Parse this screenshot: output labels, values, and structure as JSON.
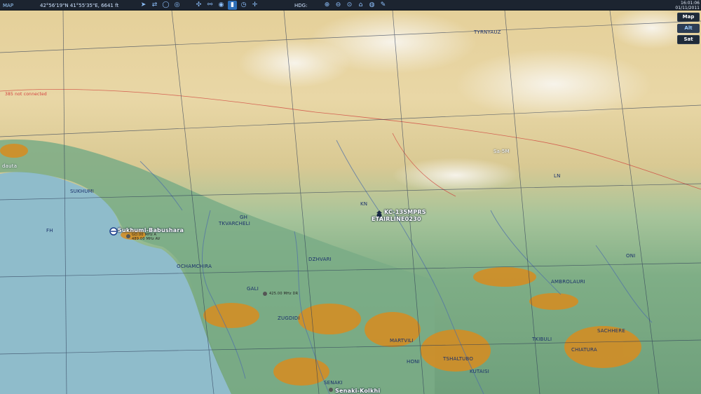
{
  "topbar": {
    "mode_label": "MAP",
    "coordinates": "42°56'19\"N 41°55'35\"E, 6641 ft",
    "hdg_label": "HDG:"
  },
  "clock": {
    "time": "16:01:06",
    "date": "01/11/2011"
  },
  "side_buttons": {
    "map": "Map",
    "alt": "Alt",
    "sat": "Sat"
  },
  "labels": {
    "tyrnyauz": "TYRNYAUZ",
    "dauta": "dauta",
    "sukhumi": "SUKHUMI",
    "fh": "FH",
    "gh": "GH",
    "tkvarcheli": "TKVARCHELI",
    "airport": "Sukhumi-Babushara",
    "freq1": "GD.00 MHz A",
    "freq2": "489.00 MHz AV",
    "ochamchira": "OCHAMCHIRA",
    "gali": "GALI",
    "freq3": "425.00 MHz DR",
    "dzhvari": "DZHVARI",
    "zugdidi": "ZUGDIDI",
    "martvili": "MARTVILI",
    "khoni": "HONI",
    "tskaltubo": "TSHALTUBO",
    "kutaisi": "KUTAISI",
    "senaki": "SENAKI",
    "kolkhi": "Senaki-Kolkhi",
    "kn": "KN",
    "aircraft1": "KC-135MPRS",
    "aircraft2": "ETAIRLINE0230",
    "ln": "LN",
    "oni": "ONI",
    "ambrolauri": "AMBROLAURI",
    "tkibuli": "TKIBULI",
    "chiatura": "CHIATURA",
    "sachhere": "SACHHERE",
    "point": "Sa-5M",
    "notconnected": "385 not connected"
  },
  "colors": {
    "sea": "#8fbccb",
    "lowland": "#78a882",
    "hills": "#e6c98a",
    "mountain": "#e9dcb8",
    "snow": "#f6f3ea",
    "urban": "#d88c1f",
    "grid": "#2c3a56",
    "border": "#d0463f",
    "river": "#4f6fa8"
  },
  "icons": [
    "compass-icon",
    "route-icon",
    "circle-icon",
    "target-icon",
    "wind-icon",
    "layers-icon",
    "zoom-in-icon",
    "zoom-out-icon",
    "globe-icon",
    "ruler-icon"
  ]
}
